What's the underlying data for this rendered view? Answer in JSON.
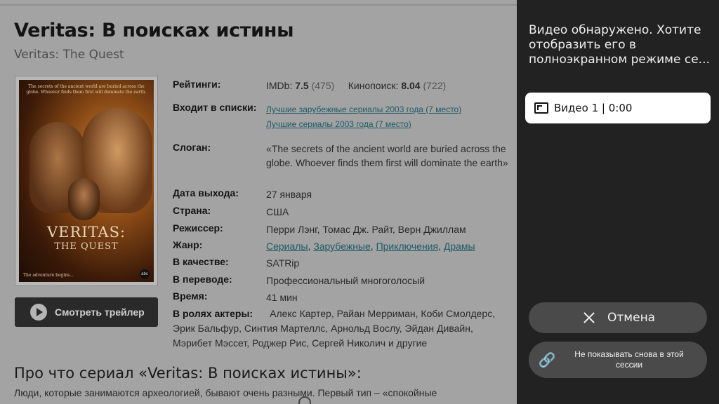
{
  "page": {
    "title": "Veritas: В поисках истины",
    "subtitle": "Veritas: The Quest",
    "poster": {
      "tagline": "The secrets of the ancient world are buried across the globe. Whoever finds them first will dominate the earth.",
      "logo_line1": "VERITAS:",
      "logo_line2": "THE QUEST",
      "bottom_text": "The adventure begins...",
      "network": "abc"
    },
    "trailer_button": "Смотреть трейлер",
    "info": {
      "ratings_label": "Рейтинги:",
      "imdb_label": "IMDb:",
      "imdb_value": "7.5",
      "imdb_votes": "(475)",
      "kp_label": "Кинопоиск:",
      "kp_value": "8.04",
      "kp_votes": "(722)",
      "lists_label": "Входит в списки:",
      "list1": "Лучшие зарубежные сериалы 2003 года (7 место)",
      "list2": "Лучшие сериалы 2003 года (7 место)",
      "slogan_label": "Слоган:",
      "slogan": "«The secrets of the ancient world are buried across the globe. Whoever finds them first will dominate the earth»",
      "release_label": "Дата выхода:",
      "release": "27 января",
      "country_label": "Страна:",
      "country": "США",
      "director_label": "Режиссер:",
      "director": "Перри Лэнг, Томас Дж. Райт, Верн Джиллам",
      "genre_label": "Жанр:",
      "genres": [
        "Сериалы",
        "Зарубежные",
        "Приключения",
        "Драмы"
      ],
      "quality_label": "В качестве:",
      "quality": "SATRip",
      "translation_label": "В переводе:",
      "translation": "Профессиональный многоголосый",
      "time_label": "Время:",
      "time": "41 мин",
      "actors_label": "В ролях актеры:",
      "actors": "Алекс Картер, Райан Мерриман, Коби Смолдерс, Эрик Бальфур, Синтия Мартеллс, Арнольд Вослу, Эйдан Дивайн, Мэрибет Мэссет, Роджер Рис, Сергей Николич и другие"
    },
    "section_title": "Про что сериал «Veritas: В поисках истины»:",
    "section_text": "Люди, которые занимаются археологией, бывают очень разными. Первый тип – «спокойные"
  },
  "dialog": {
    "prompt": "Видео обнаружено. Хотите отобразить его в полноэкранном режиме се...",
    "video_item": "Видео 1 | 0:00",
    "cancel": "Отмена",
    "dont_show": "Не показывать снова в этой сессии"
  }
}
